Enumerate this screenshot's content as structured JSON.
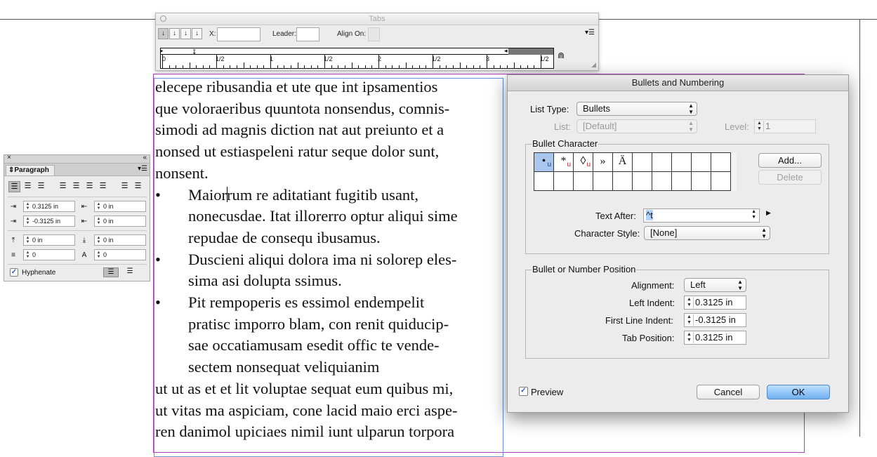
{
  "tabs_panel": {
    "title": "Tabs",
    "x_label": "X:",
    "x_value": "",
    "leader_label": "Leader:",
    "leader_value": "",
    "align_on_label": "Align On:",
    "align_on_value": "",
    "buttons": [
      "left-justified-tab",
      "center-justified-tab",
      "right-justified-tab",
      "align-to-decimal-tab"
    ],
    "ruler_numbers": [
      "0",
      "1/2",
      "1",
      "1/2",
      "2",
      "1/2",
      "3",
      "1/2"
    ],
    "menu_icon": "panel-menu-icon",
    "magnet_icon": "position-panel-above-frame-icon"
  },
  "paragraph_panel": {
    "tab_label": "Paragraph",
    "left_indent": "0.3125 in",
    "right_indent": "0 in",
    "first_line_indent": "-0.3125 in",
    "last_line_indent": "0 in",
    "space_before": "0 in",
    "space_after": "0 in",
    "drop_cap_lines": "0",
    "drop_cap_chars": "0",
    "hyphenate_label": "Hyphenate",
    "hyphenate_checked": true
  },
  "story": {
    "paragraph1": [
      "elecepe ribusandia et ute que int ipsamentios",
      "que voloraeribus quuntota nonsendus, comnis-",
      "simodi ad magnis diction nat aut preiunto et a",
      "nonsed ut estiaspeleni ratur seque dolor sunt,",
      "nonsent."
    ],
    "bullet_symbol": "•",
    "list_item_1_caret_before": "Maior",
    "list_item_1_caret_after": "rum re aditatiant fugitib usant,",
    "list_item_1": [
      "nonecusdae. Itat illorerro optur aliqui sime",
      "repudae de consequ ibusamus."
    ],
    "list_item_2": [
      "Duscieni aliqui dolora ima ni solorep eles-",
      "sima asi dolupta ssimus."
    ],
    "list_item_3": [
      "Pit rempореris es essimol endempelit",
      "pratisc imporro blam, con renit quiducip-",
      "sae occatiamusam esedit offic te vende-",
      "sectem nonsequat veliquianim"
    ],
    "paragraph2": [
      "ut ut as et et lit voluptae sequat eum quibus mi,",
      "ut vitas ma aspiciam, cone lacid maio erci aspe-",
      "ren danimol upiciaes nimil iunt ulparun torpora"
    ]
  },
  "dialog": {
    "title": "Bullets and Numbering",
    "list_type_label": "List Type:",
    "list_type_value": "Bullets",
    "list_label": "List:",
    "list_value": "[Default]",
    "level_label": "Level:",
    "level_value": "1",
    "bullet_character_group": "Bullet Character",
    "bullet_glyphs": [
      "•",
      "*",
      "◊",
      "»",
      "Ä"
    ],
    "bullet_glyph_u_flags": [
      true,
      true,
      true,
      false,
      false
    ],
    "bullet_u_mark": "u",
    "add_button": "Add...",
    "delete_button": "Delete",
    "text_after_label": "Text After:",
    "text_after_value": "^t",
    "character_style_label": "Character Style:",
    "character_style_value": "[None]",
    "position_group": "Bullet or Number Position",
    "alignment_label": "Alignment:",
    "alignment_value": "Left",
    "left_indent_label": "Left Indent:",
    "left_indent_value": "0.3125 in",
    "first_line_indent_label": "First Line Indent:",
    "first_line_indent_value": "-0.3125 in",
    "tab_position_label": "Tab Position:",
    "tab_position_value": "0.3125 in",
    "preview_label": "Preview",
    "preview_checked": true,
    "cancel_button": "Cancel",
    "ok_button": "OK"
  },
  "colors": {
    "frame_outline": "#b13bc4",
    "text_frame": "#6a8fd8",
    "selection": "#a9c6ee",
    "default_button": "#6fb0f0"
  }
}
